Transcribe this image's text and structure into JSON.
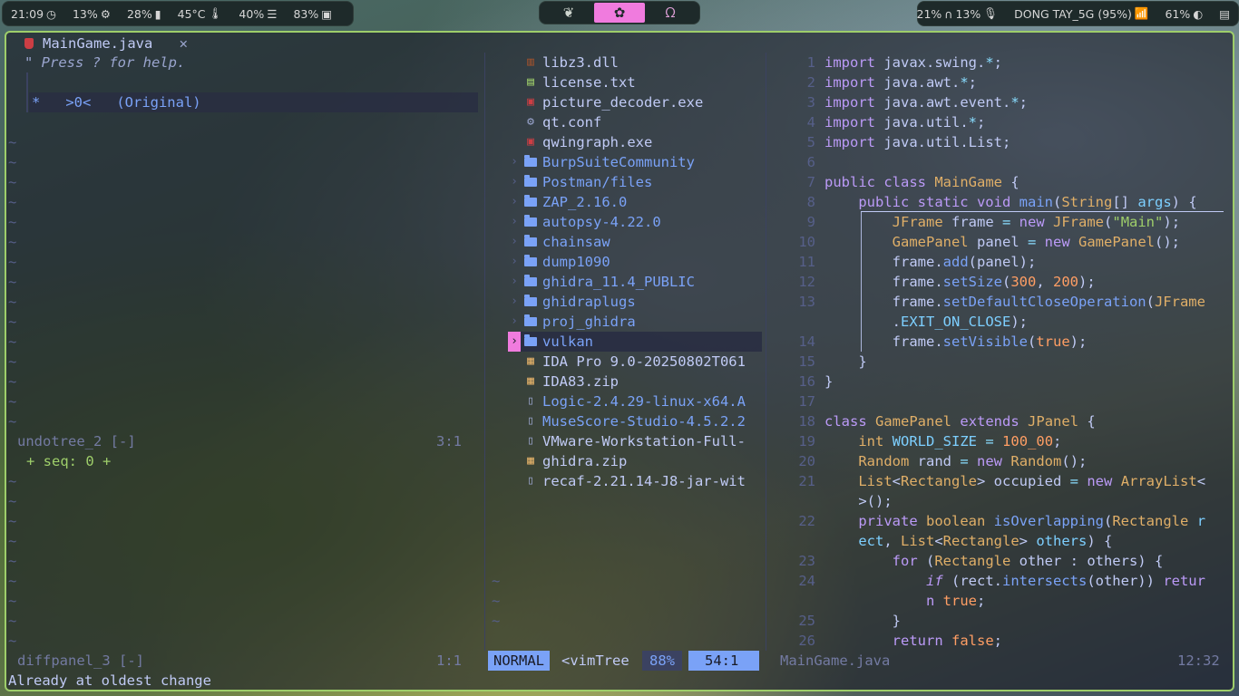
{
  "topbar": {
    "time": "21:09",
    "cpu": "13%",
    "memory": "28%",
    "temperature": "45°C",
    "brightness": "40%",
    "battery_left": "83%",
    "mic": "21%",
    "volume": "13%",
    "wifi_name": "DONG TAY_5G (95%)",
    "battery_right": "61%",
    "workspaces": [
      "leaf",
      "flower",
      "ribbon"
    ],
    "active_workspace": 1,
    "accent": "#f07bde"
  },
  "left": {
    "tab_title": "MainGame.java",
    "tab_close": "✕",
    "help": "\" Press ? for help.",
    "tree_entry": "*   >0<   (Original)",
    "undotree_status": "undotree_2 [-]",
    "undotree_pos": "3:1",
    "seq": "+ seq: 0 +",
    "diffpanel_status": "diffpanel_3 [-]",
    "diffpanel_pos": "1:1"
  },
  "files": [
    {
      "name": "libz3.dll",
      "kind": "file",
      "icon": "dll-icon",
      "color": "#a0522d"
    },
    {
      "name": "license.txt",
      "kind": "file",
      "icon": "text-file-icon",
      "color": "#9ece6a"
    },
    {
      "name": "picture_decoder.exe",
      "kind": "file",
      "icon": "exe-icon",
      "color": "#cc3e44"
    },
    {
      "name": "qt.conf",
      "kind": "file",
      "icon": "gear-icon",
      "color": "#9aa5ce"
    },
    {
      "name": "qwingraph.exe",
      "kind": "file",
      "icon": "exe-icon",
      "color": "#cc3e44"
    },
    {
      "name": "BurpSuiteCommunity",
      "kind": "dir",
      "icon": "folder-icon",
      "color": "#7aa2f7"
    },
    {
      "name": "Postman/files",
      "kind": "dir",
      "icon": "folder-icon",
      "color": "#7aa2f7"
    },
    {
      "name": "ZAP_2.16.0",
      "kind": "dir",
      "icon": "folder-icon",
      "color": "#7aa2f7"
    },
    {
      "name": "autopsy-4.22.0",
      "kind": "dir",
      "icon": "folder-icon",
      "color": "#7aa2f7"
    },
    {
      "name": "chainsaw",
      "kind": "dir",
      "icon": "folder-icon",
      "color": "#7aa2f7"
    },
    {
      "name": "dump1090",
      "kind": "dir",
      "icon": "folder-icon",
      "color": "#7aa2f7"
    },
    {
      "name": "ghidra_11.4_PUBLIC",
      "kind": "dir",
      "icon": "folder-icon",
      "color": "#7aa2f7"
    },
    {
      "name": "ghidraplugs",
      "kind": "dir",
      "icon": "folder-icon",
      "color": "#7aa2f7"
    },
    {
      "name": "proj_ghidra",
      "kind": "dir",
      "icon": "folder-icon",
      "color": "#7aa2f7"
    },
    {
      "name": "vulkan",
      "kind": "dir",
      "icon": "folder-icon",
      "color": "#7aa2f7",
      "selected": true
    },
    {
      "name": "IDA Pro 9.0-20250802T061",
      "kind": "file",
      "icon": "archive-icon",
      "color": "#e0af68"
    },
    {
      "name": "IDA83.zip",
      "kind": "file",
      "icon": "archive-icon",
      "color": "#e0af68"
    },
    {
      "name": "Logic-2.4.29-linux-x64.A",
      "kind": "file",
      "icon": "document-icon",
      "color": "#9aa5ce",
      "tint": "#7aa2f7"
    },
    {
      "name": "MuseScore-Studio-4.5.2.2",
      "kind": "file",
      "icon": "document-icon",
      "color": "#9aa5ce",
      "tint": "#7aa2f7"
    },
    {
      "name": "VMware-Workstation-Full-",
      "kind": "file",
      "icon": "document-icon",
      "color": "#9aa5ce"
    },
    {
      "name": "ghidra.zip",
      "kind": "file",
      "icon": "archive-icon",
      "color": "#e0af68"
    },
    {
      "name": "recaf-2.21.14-J8-jar-wit",
      "kind": "file",
      "icon": "document-icon",
      "color": "#9aa5ce"
    }
  ],
  "code": {
    "lines": [
      {
        "n": "1",
        "html": "<span class='kw'>import</span> javax.swing.<span class='op'>*</span>;"
      },
      {
        "n": "2",
        "html": "<span class='kw'>import</span> java.awt.<span class='op'>*</span>;"
      },
      {
        "n": "3",
        "html": "<span class='kw'>import</span> java.awt.event.<span class='op'>*</span>;"
      },
      {
        "n": "4",
        "html": "<span class='kw'>import</span> java.util.<span class='op'>*</span>;"
      },
      {
        "n": "5",
        "html": "<span class='kw'>import</span> java.util.List;"
      },
      {
        "n": "6",
        "html": ""
      },
      {
        "n": "7",
        "html": "<span class='kw'>public class</span> <span class='ty'>MainGame</span> {"
      },
      {
        "n": "8",
        "html": "    <span class='kw'>public static void</span> <span class='fn'>main</span>(<span class='ty'>String</span>[] <span class='vr'>args</span>) {"
      },
      {
        "n": "9",
        "html": "        <span class='ty'>JFrame</span> frame <span class='op'>=</span> <span class='kw'>new</span> <span class='ty'>JFrame</span>(<span class='st'>\"Main\"</span>);"
      },
      {
        "n": "10",
        "html": "        <span class='ty'>GamePanel</span> panel <span class='op'>=</span> <span class='kw'>new</span> <span class='ty'>GamePanel</span>();"
      },
      {
        "n": "11",
        "html": "        frame.<span class='fn'>add</span>(panel);"
      },
      {
        "n": "12",
        "html": "        frame.<span class='fn'>setSize</span>(<span class='nu'>300</span>, <span class='nu'>200</span>);"
      },
      {
        "n": "13",
        "html": "        frame.<span class='fn'>setDefaultCloseOperation</span>(<span class='ty'>JFrame</span>"
      },
      {
        "n": "",
        "html": "        .<span class='vr'>EXIT_ON_CLOSE</span>);"
      },
      {
        "n": "14",
        "html": "        frame.<span class='fn'>setVisible</span>(<span class='nu'>true</span>);"
      },
      {
        "n": "15",
        "html": "    }"
      },
      {
        "n": "16",
        "html": "}"
      },
      {
        "n": "17",
        "html": ""
      },
      {
        "n": "18",
        "html": "<span class='kw'>class</span> <span class='ty'>GamePanel</span> <span class='kw'>extends</span> <span class='ty'>JPanel</span> {"
      },
      {
        "n": "19",
        "html": "    <span class='ty'>int</span> <span class='vr'>WORLD_SIZE</span> <span class='op'>=</span> <span class='nu'>100_00</span>;"
      },
      {
        "n": "20",
        "html": "    <span class='ty'>Random</span> rand <span class='op'>=</span> <span class='kw'>new</span> <span class='ty'>Random</span>();"
      },
      {
        "n": "21",
        "html": "    <span class='ty'>List</span>&lt;<span class='ty'>Rectangle</span>&gt; occupied <span class='op'>=</span> <span class='kw'>new</span> <span class='ty'>ArrayList</span>&lt;"
      },
      {
        "n": "",
        "html": "    &gt;();"
      },
      {
        "n": "22",
        "html": "    <span class='kw'>private</span> <span class='ty'>boolean</span> <span class='fn'>isOverlapping</span>(<span class='ty'>Rectangle</span> <span class='vr'>r</span>"
      },
      {
        "n": "",
        "html": "    <span class='vr'>ect</span>, <span class='ty'>List</span>&lt;<span class='ty'>Rectangle</span>&gt; <span class='vr'>others</span>) {"
      },
      {
        "n": "23",
        "html": "        <span class='kw'>for</span> (<span class='ty'>Rectangle</span> other : others) {"
      },
      {
        "n": "24",
        "html": "            <span class='kw it'>if</span> (rect.<span class='fn'>intersects</span>(other)) <span class='kw'>retur</span>"
      },
      {
        "n": "",
        "html": "            <span class='kw'>n</span> <span class='nu'>true</span>;"
      },
      {
        "n": "25",
        "html": "        }"
      },
      {
        "n": "26",
        "html": "        <span class='kw'>return</span> <span class='nu'>false</span>;"
      }
    ]
  },
  "statusline": {
    "mode": "NORMAL",
    "buffer": "<vimTree",
    "percent": "88%",
    "cursor": "54:1",
    "right_file": "MainGame.java",
    "right_pos": "12:32"
  },
  "message": "Already at oldest change"
}
